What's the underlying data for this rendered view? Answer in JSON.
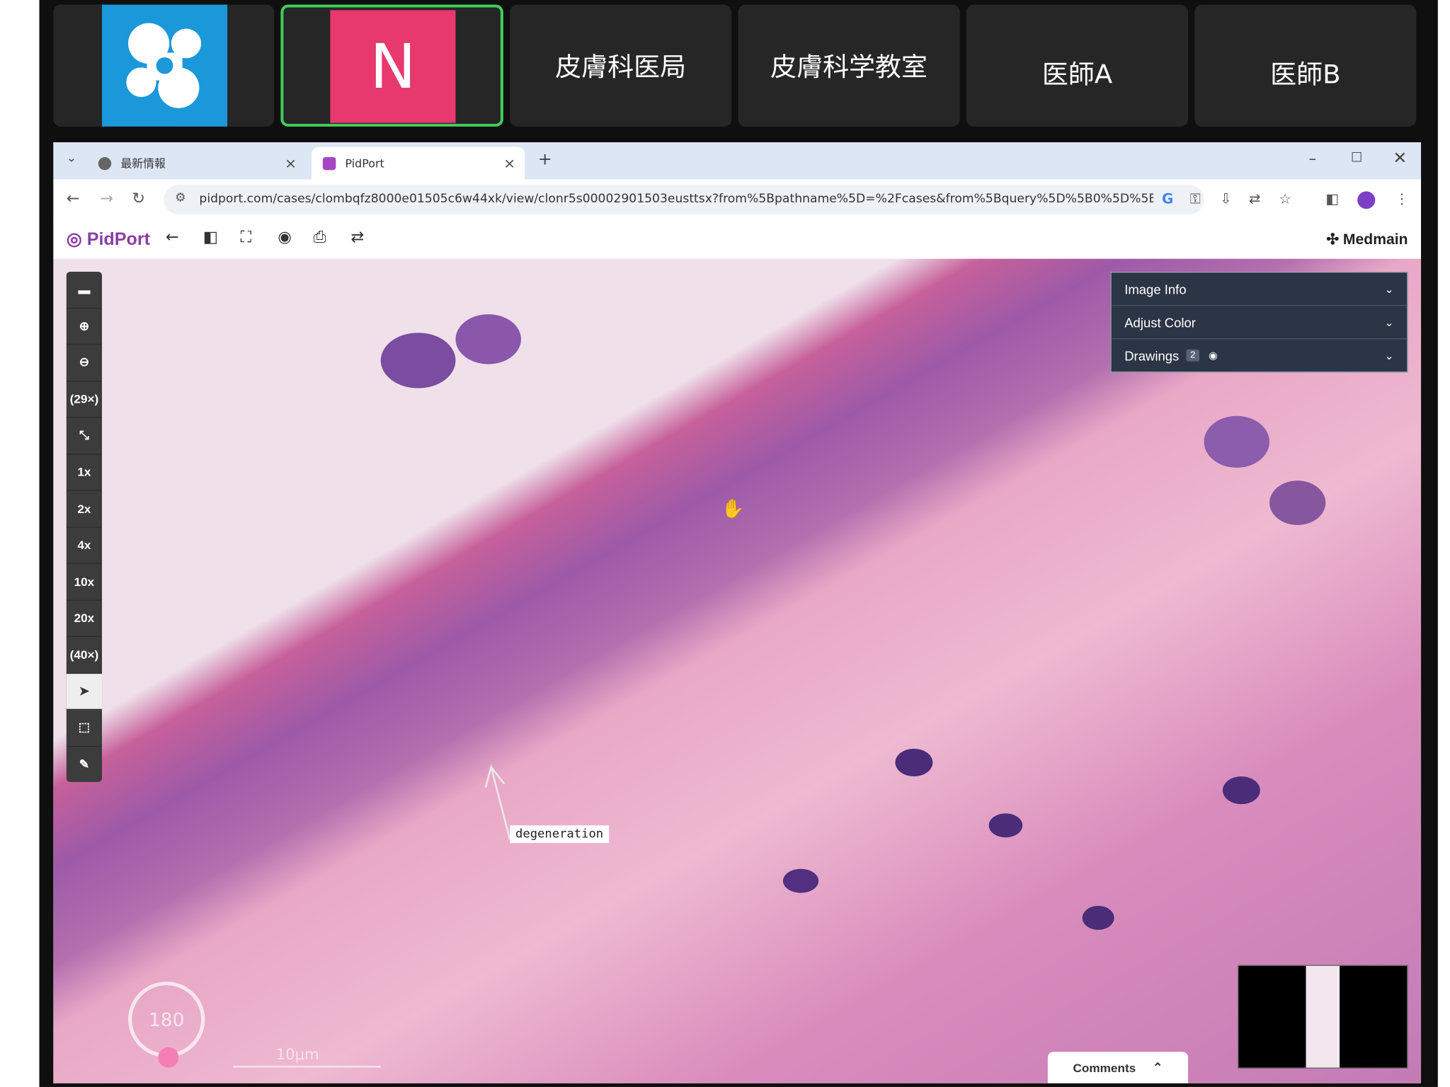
{
  "meeting": {
    "participants": [
      {
        "name": "N",
        "kind": "avatar",
        "active": true
      },
      {
        "name": "皮膚科医局"
      },
      {
        "name": "皮膚科学教室"
      },
      {
        "name": "医師A"
      },
      {
        "name": "医師B"
      }
    ]
  },
  "browser": {
    "tabs": [
      {
        "label": "最新情報"
      },
      {
        "label": "PidPort"
      }
    ],
    "url": "pidport.com/cases/clombqfz8000e01505c6w44xk/view/clonr5s00002901503eusttsx?from%5Bpathname%5D=%2Fcases&from%5Bquery%5D%5B0%5D%5Bfield%5D..."
  },
  "app": {
    "brand": "PidPort",
    "partner": "Medmain"
  },
  "viewer": {
    "left_tools": [
      "(29×)",
      "1x",
      "2x",
      "4x",
      "10x",
      "20x",
      "(40×)"
    ],
    "panel": {
      "image_info": "Image Info",
      "adjust_color": "Adjust Color",
      "drawings": "Drawings",
      "drawings_count": "2"
    },
    "annotation": "degeneration",
    "rotation": "180",
    "scale_label": "10μm",
    "comments": "Comments"
  },
  "colors": {
    "active_border": "#3fcf5a",
    "avatar_bg": "#e8396f",
    "logo_bg": "#1a98d9",
    "brand": "#8a3fa6"
  }
}
